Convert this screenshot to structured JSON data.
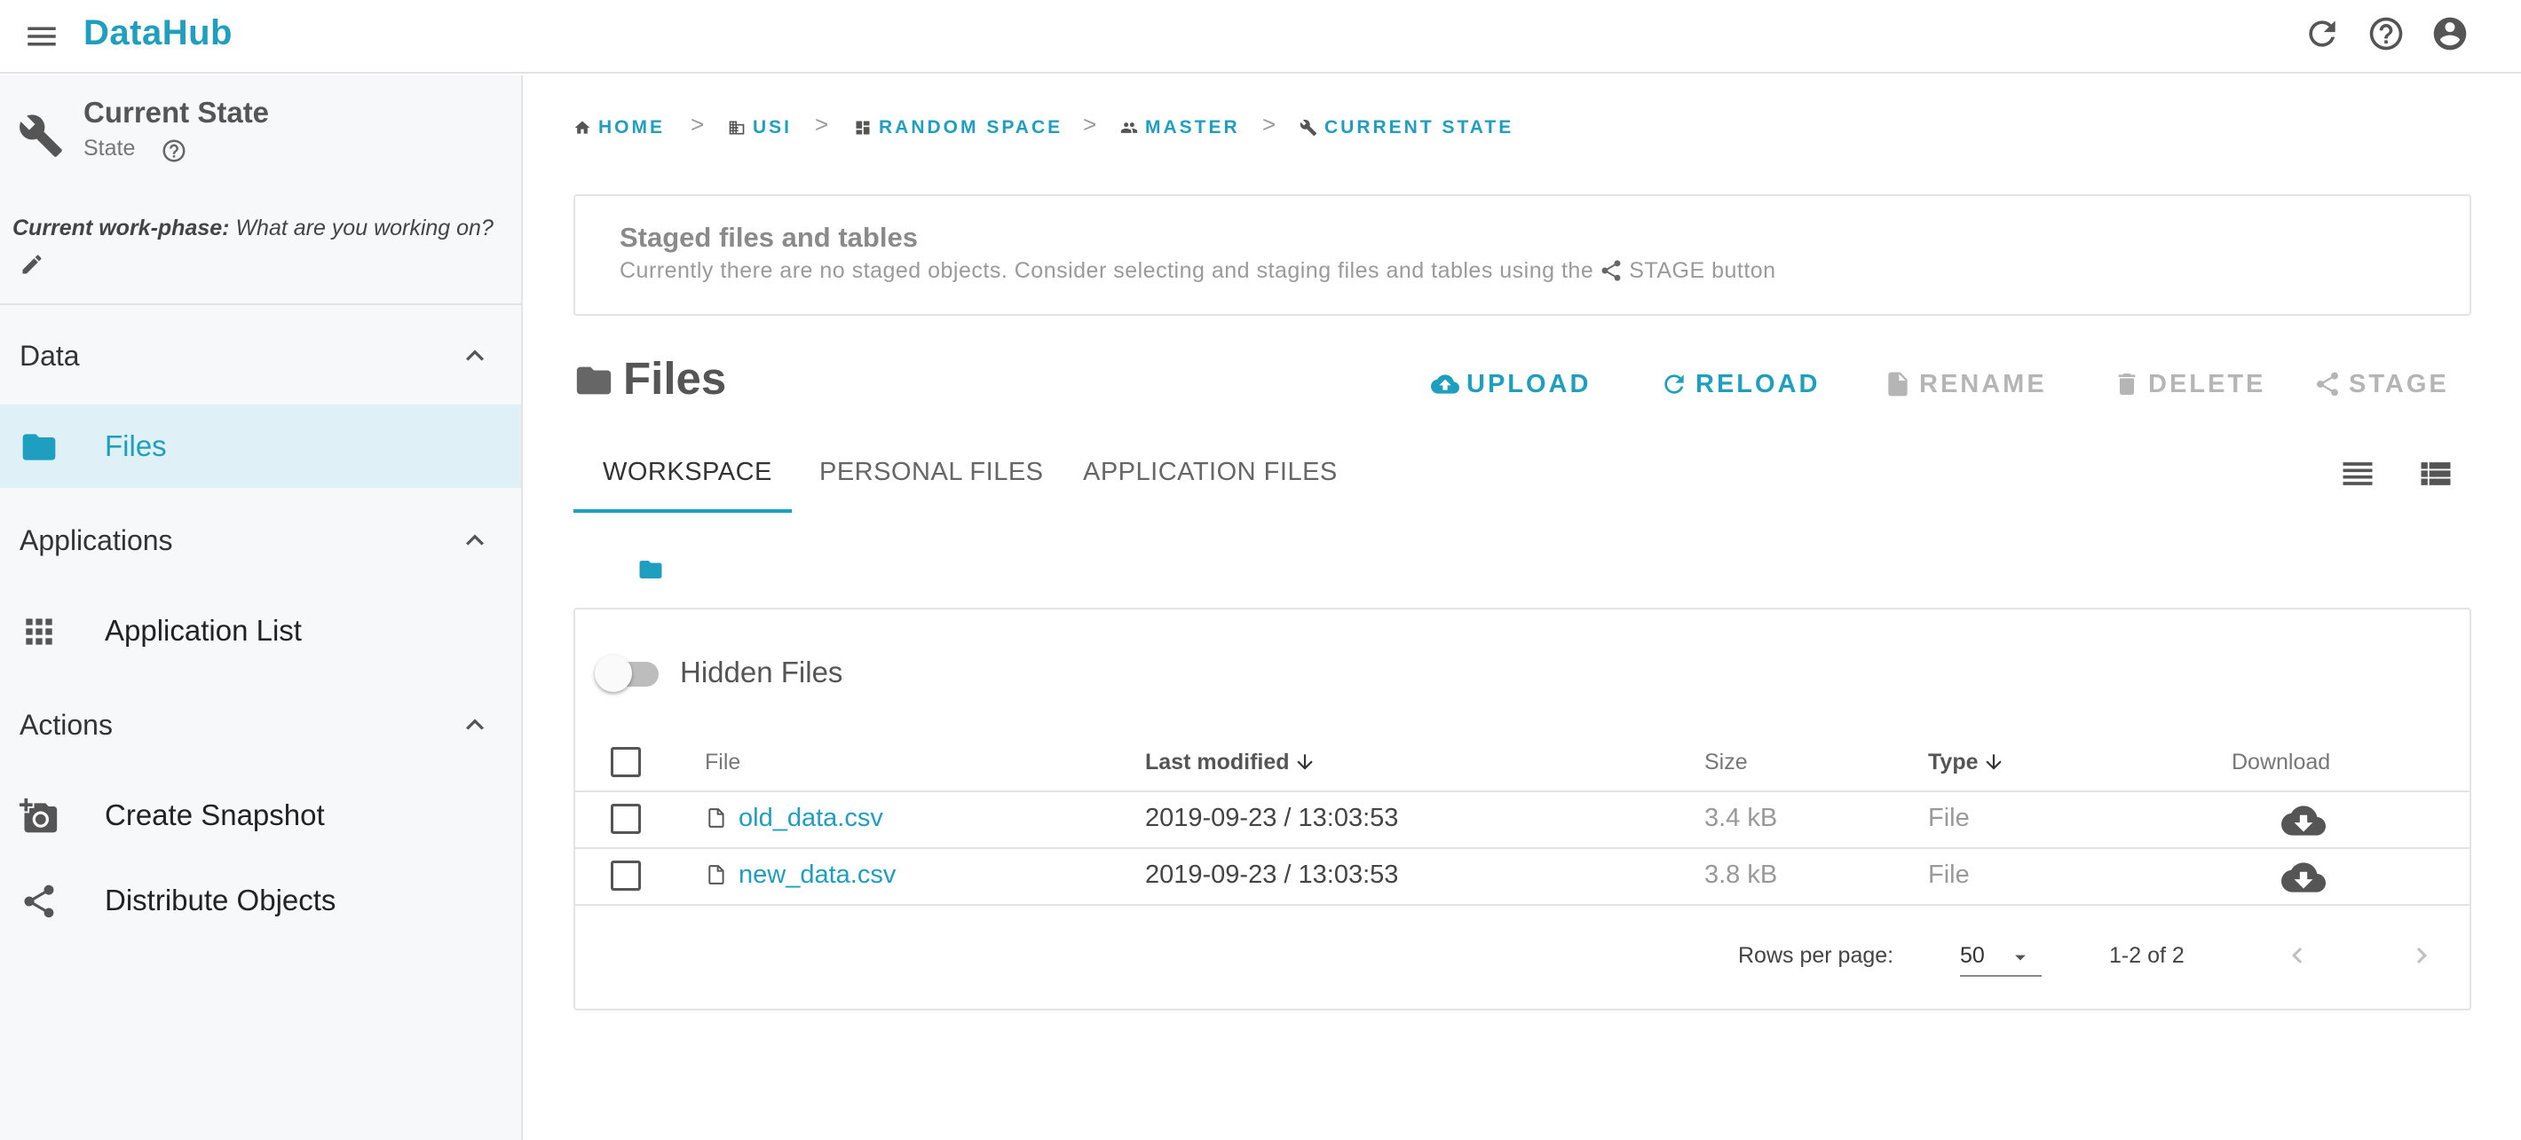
{
  "app": {
    "brand": "DataHub",
    "accent_color": "#1f9fbf",
    "top_icons": [
      "refresh-icon",
      "help-icon",
      "account-icon"
    ]
  },
  "sidebar": {
    "title": "Current State",
    "subtitle": "State",
    "work_phase_label": "Current work-phase:",
    "work_phase_value": "What are you working on?",
    "sections": [
      {
        "label": "Data",
        "items": [
          {
            "label": "Files",
            "icon": "folder-icon",
            "active": true
          }
        ]
      },
      {
        "label": "Applications",
        "items": [
          {
            "label": "Application List",
            "icon": "grid-icon"
          }
        ]
      },
      {
        "label": "Actions",
        "items": [
          {
            "label": "Create Snapshot",
            "icon": "add-camera-icon"
          },
          {
            "label": "Distribute Objects",
            "icon": "share-icon"
          }
        ]
      }
    ]
  },
  "breadcrumb": [
    {
      "label": "HOME",
      "icon": "home-icon"
    },
    {
      "label": "USI",
      "icon": "building-icon"
    },
    {
      "label": "RANDOM SPACE",
      "icon": "dashboard-icon"
    },
    {
      "label": "MASTER",
      "icon": "people-icon"
    },
    {
      "label": "CURRENT STATE",
      "icon": "wrench-icon"
    }
  ],
  "breadcrumb_separator": ">",
  "staged": {
    "title": "Staged files and tables",
    "text": "Currently there are no staged objects. Consider selecting and staging files and tables using the",
    "button_ref": "STAGE button"
  },
  "files": {
    "title": "Files",
    "actions": [
      {
        "label": "UPLOAD",
        "icon": "cloud-upload-icon",
        "enabled": true
      },
      {
        "label": "RELOAD",
        "icon": "reload-icon",
        "enabled": true
      },
      {
        "label": "RENAME",
        "icon": "file-icon",
        "enabled": false
      },
      {
        "label": "DELETE",
        "icon": "trash-icon",
        "enabled": false
      },
      {
        "label": "STAGE",
        "icon": "share-icon",
        "enabled": false
      }
    ],
    "tabs": [
      {
        "label": "WORKSPACE",
        "active": true
      },
      {
        "label": "PERSONAL FILES",
        "active": false
      },
      {
        "label": "APPLICATION FILES",
        "active": false
      }
    ],
    "hidden_files_label": "Hidden Files",
    "hidden_files_on": false,
    "columns": {
      "file": "File",
      "last_modified": "Last modified",
      "size": "Size",
      "type": "Type",
      "download": "Download"
    },
    "rows": [
      {
        "name": "old_data.csv",
        "modified": "2019-09-23 / 13:03:53",
        "size": "3.4 kB",
        "type": "File"
      },
      {
        "name": "new_data.csv",
        "modified": "2019-09-23 / 13:03:53",
        "size": "3.8 kB",
        "type": "File"
      }
    ],
    "pagination": {
      "rows_per_page_label": "Rows per page:",
      "rows_per_page": "50",
      "range": "1-2 of 2"
    }
  }
}
